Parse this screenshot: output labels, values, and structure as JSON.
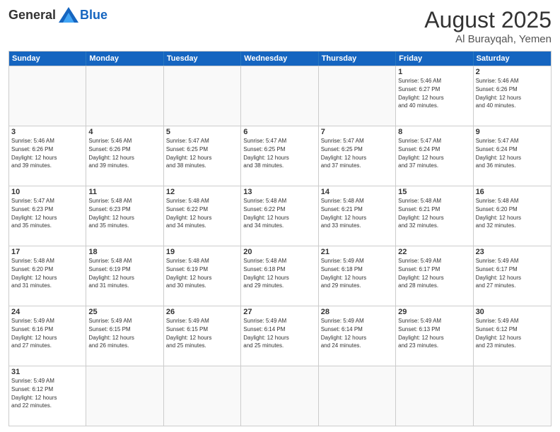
{
  "logo": {
    "general": "General",
    "blue": "Blue"
  },
  "title": "August 2025",
  "location": "Al Burayqah, Yemen",
  "header_days": [
    "Sunday",
    "Monday",
    "Tuesday",
    "Wednesday",
    "Thursday",
    "Friday",
    "Saturday"
  ],
  "rows": [
    [
      {
        "day": "",
        "info": ""
      },
      {
        "day": "",
        "info": ""
      },
      {
        "day": "",
        "info": ""
      },
      {
        "day": "",
        "info": ""
      },
      {
        "day": "",
        "info": ""
      },
      {
        "day": "1",
        "info": "Sunrise: 5:46 AM\nSunset: 6:27 PM\nDaylight: 12 hours\nand 40 minutes."
      },
      {
        "day": "2",
        "info": "Sunrise: 5:46 AM\nSunset: 6:26 PM\nDaylight: 12 hours\nand 40 minutes."
      }
    ],
    [
      {
        "day": "3",
        "info": "Sunrise: 5:46 AM\nSunset: 6:26 PM\nDaylight: 12 hours\nand 39 minutes."
      },
      {
        "day": "4",
        "info": "Sunrise: 5:46 AM\nSunset: 6:26 PM\nDaylight: 12 hours\nand 39 minutes."
      },
      {
        "day": "5",
        "info": "Sunrise: 5:47 AM\nSunset: 6:25 PM\nDaylight: 12 hours\nand 38 minutes."
      },
      {
        "day": "6",
        "info": "Sunrise: 5:47 AM\nSunset: 6:25 PM\nDaylight: 12 hours\nand 38 minutes."
      },
      {
        "day": "7",
        "info": "Sunrise: 5:47 AM\nSunset: 6:25 PM\nDaylight: 12 hours\nand 37 minutes."
      },
      {
        "day": "8",
        "info": "Sunrise: 5:47 AM\nSunset: 6:24 PM\nDaylight: 12 hours\nand 37 minutes."
      },
      {
        "day": "9",
        "info": "Sunrise: 5:47 AM\nSunset: 6:24 PM\nDaylight: 12 hours\nand 36 minutes."
      }
    ],
    [
      {
        "day": "10",
        "info": "Sunrise: 5:47 AM\nSunset: 6:23 PM\nDaylight: 12 hours\nand 35 minutes."
      },
      {
        "day": "11",
        "info": "Sunrise: 5:48 AM\nSunset: 6:23 PM\nDaylight: 12 hours\nand 35 minutes."
      },
      {
        "day": "12",
        "info": "Sunrise: 5:48 AM\nSunset: 6:22 PM\nDaylight: 12 hours\nand 34 minutes."
      },
      {
        "day": "13",
        "info": "Sunrise: 5:48 AM\nSunset: 6:22 PM\nDaylight: 12 hours\nand 34 minutes."
      },
      {
        "day": "14",
        "info": "Sunrise: 5:48 AM\nSunset: 6:21 PM\nDaylight: 12 hours\nand 33 minutes."
      },
      {
        "day": "15",
        "info": "Sunrise: 5:48 AM\nSunset: 6:21 PM\nDaylight: 12 hours\nand 32 minutes."
      },
      {
        "day": "16",
        "info": "Sunrise: 5:48 AM\nSunset: 6:20 PM\nDaylight: 12 hours\nand 32 minutes."
      }
    ],
    [
      {
        "day": "17",
        "info": "Sunrise: 5:48 AM\nSunset: 6:20 PM\nDaylight: 12 hours\nand 31 minutes."
      },
      {
        "day": "18",
        "info": "Sunrise: 5:48 AM\nSunset: 6:19 PM\nDaylight: 12 hours\nand 31 minutes."
      },
      {
        "day": "19",
        "info": "Sunrise: 5:48 AM\nSunset: 6:19 PM\nDaylight: 12 hours\nand 30 minutes."
      },
      {
        "day": "20",
        "info": "Sunrise: 5:48 AM\nSunset: 6:18 PM\nDaylight: 12 hours\nand 29 minutes."
      },
      {
        "day": "21",
        "info": "Sunrise: 5:49 AM\nSunset: 6:18 PM\nDaylight: 12 hours\nand 29 minutes."
      },
      {
        "day": "22",
        "info": "Sunrise: 5:49 AM\nSunset: 6:17 PM\nDaylight: 12 hours\nand 28 minutes."
      },
      {
        "day": "23",
        "info": "Sunrise: 5:49 AM\nSunset: 6:17 PM\nDaylight: 12 hours\nand 27 minutes."
      }
    ],
    [
      {
        "day": "24",
        "info": "Sunrise: 5:49 AM\nSunset: 6:16 PM\nDaylight: 12 hours\nand 27 minutes."
      },
      {
        "day": "25",
        "info": "Sunrise: 5:49 AM\nSunset: 6:15 PM\nDaylight: 12 hours\nand 26 minutes."
      },
      {
        "day": "26",
        "info": "Sunrise: 5:49 AM\nSunset: 6:15 PM\nDaylight: 12 hours\nand 25 minutes."
      },
      {
        "day": "27",
        "info": "Sunrise: 5:49 AM\nSunset: 6:14 PM\nDaylight: 12 hours\nand 25 minutes."
      },
      {
        "day": "28",
        "info": "Sunrise: 5:49 AM\nSunset: 6:14 PM\nDaylight: 12 hours\nand 24 minutes."
      },
      {
        "day": "29",
        "info": "Sunrise: 5:49 AM\nSunset: 6:13 PM\nDaylight: 12 hours\nand 23 minutes."
      },
      {
        "day": "30",
        "info": "Sunrise: 5:49 AM\nSunset: 6:12 PM\nDaylight: 12 hours\nand 23 minutes."
      }
    ],
    [
      {
        "day": "31",
        "info": "Sunrise: 5:49 AM\nSunset: 6:12 PM\nDaylight: 12 hours\nand 22 minutes."
      },
      {
        "day": "",
        "info": ""
      },
      {
        "day": "",
        "info": ""
      },
      {
        "day": "",
        "info": ""
      },
      {
        "day": "",
        "info": ""
      },
      {
        "day": "",
        "info": ""
      },
      {
        "day": "",
        "info": ""
      }
    ]
  ]
}
